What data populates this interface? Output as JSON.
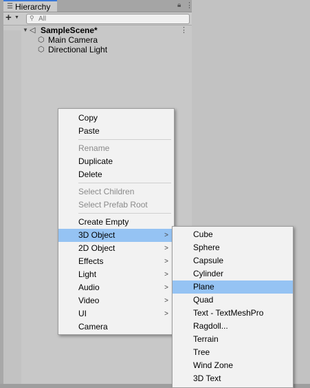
{
  "hierarchy": {
    "tab_label": "Hierarchy",
    "search_placeholder": "All",
    "scene": {
      "name": "SampleScene*",
      "objects": [
        "Main Camera",
        "Directional Light"
      ]
    }
  },
  "context_menu": {
    "group1": [
      "Copy",
      "Paste"
    ],
    "group2": [
      "Rename",
      "Duplicate",
      "Delete"
    ],
    "group3": [
      "Select Children",
      "Select Prefab Root"
    ],
    "group4": [
      "Create Empty",
      "3D Object",
      "2D Object",
      "Effects",
      "Light",
      "Audio",
      "Video",
      "UI",
      "Camera"
    ],
    "highlighted": "3D Object"
  },
  "submenu_3d_object": {
    "items": [
      "Cube",
      "Sphere",
      "Capsule",
      "Cylinder",
      "Plane",
      "Quad",
      "Text - TextMeshPro",
      "Ragdoll...",
      "Terrain",
      "Tree",
      "Wind Zone",
      "3D Text"
    ],
    "highlighted": "Plane"
  },
  "colors": {
    "highlight": "#95c3f3",
    "tab_accent": "#3a79d9"
  }
}
